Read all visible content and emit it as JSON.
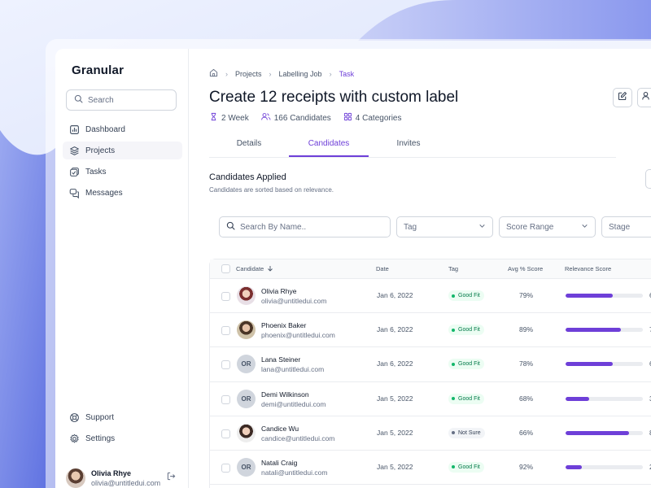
{
  "app": {
    "name": "Granular"
  },
  "sidebar": {
    "search_placeholder": "Search",
    "items": [
      {
        "label": "Dashboard",
        "icon": "bar-chart-icon"
      },
      {
        "label": "Projects",
        "icon": "layers-icon",
        "active": true
      },
      {
        "label": "Tasks",
        "icon": "tasks-icon"
      },
      {
        "label": "Messages",
        "icon": "messages-icon"
      }
    ],
    "bottom_items": [
      {
        "label": "Support",
        "icon": "lifebuoy-icon"
      },
      {
        "label": "Settings",
        "icon": "gear-icon"
      }
    ],
    "user": {
      "name": "Olivia Rhye",
      "email": "olivia@untitledui.com"
    }
  },
  "breadcrumb": [
    "Projects",
    "Labelling Job",
    "Task"
  ],
  "page": {
    "title": "Create 12 receipts with custom label",
    "meta": [
      {
        "icon": "hourglass-icon",
        "text": "2 Week"
      },
      {
        "icon": "users-icon",
        "text": "166 Candidates"
      },
      {
        "icon": "grid-icon",
        "text": "4 Categories"
      }
    ]
  },
  "tabs": [
    {
      "label": "Details"
    },
    {
      "label": "Candidates",
      "active": true
    },
    {
      "label": "Invites"
    }
  ],
  "section": {
    "title": "Candidates Applied",
    "subtitle": "Candidates are sorted based on relevance."
  },
  "filters": {
    "search_placeholder": "Search By Name..",
    "tag": "Tag",
    "score_range": "Score Range",
    "stage": "Stage"
  },
  "table": {
    "headers": {
      "candidate": "Candidate",
      "date": "Date",
      "tag": "Tag",
      "avg_score": "Avg % Score",
      "relevance": "Relevance Score"
    },
    "rows": [
      {
        "name": "Olivia Rhye",
        "email": "olivia@untitledui.com",
        "avatar": "photo1",
        "initials": "",
        "date": "Jan 6, 2022",
        "tag": "Good Fit",
        "tag_type": "good",
        "avg": "79%",
        "relevance": 0.61,
        "relevance_label": "6"
      },
      {
        "name": "Phoenix Baker",
        "email": "phoenix@untitledui.com",
        "avatar": "photo2",
        "initials": "",
        "date": "Jan 6, 2022",
        "tag": "Good Fit",
        "tag_type": "good",
        "avg": "89%",
        "relevance": 0.72,
        "relevance_label": "7"
      },
      {
        "name": "Lana Steiner",
        "email": "lana@untitledui.com",
        "avatar": "initials",
        "initials": "OR",
        "date": "Jan 6, 2022",
        "tag": "Good Fit",
        "tag_type": "good",
        "avg": "78%",
        "relevance": 0.61,
        "relevance_label": "6"
      },
      {
        "name": "Demi Wilkinson",
        "email": "demi@untitledui.com",
        "avatar": "initials",
        "initials": "OR",
        "date": "Jan 5, 2022",
        "tag": "Good Fit",
        "tag_type": "good",
        "avg": "68%",
        "relevance": 0.31,
        "relevance_label": "3"
      },
      {
        "name": "Candice Wu",
        "email": "candice@untitledui.com",
        "avatar": "photo3",
        "initials": "",
        "date": "Jan 5, 2022",
        "tag": "Not Sure",
        "tag_type": "unsure",
        "avg": "66%",
        "relevance": 0.82,
        "relevance_label": "8"
      },
      {
        "name": "Natali Craig",
        "email": "natali@untitledui.com",
        "avatar": "initials",
        "initials": "OR",
        "date": "Jan 5, 2022",
        "tag": "Good Fit",
        "tag_type": "good",
        "avg": "92%",
        "relevance": 0.21,
        "relevance_label": "2"
      }
    ]
  },
  "colors": {
    "accent": "#6e3fd8",
    "good": "#12b76a"
  }
}
